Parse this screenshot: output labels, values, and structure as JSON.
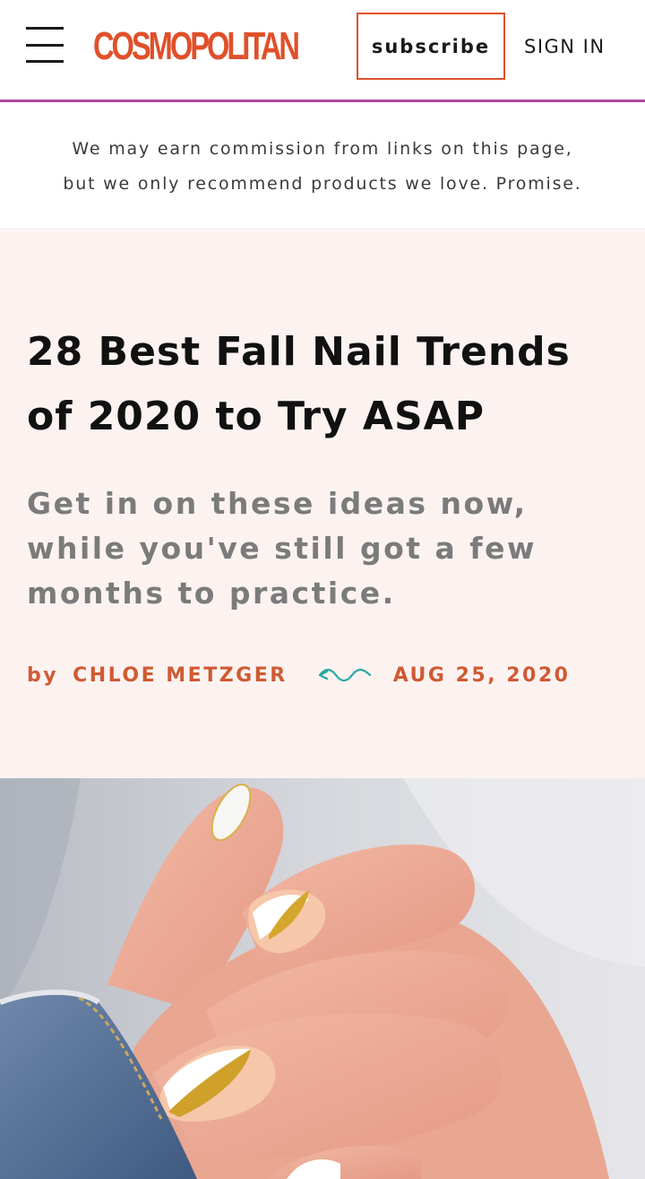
{
  "header": {
    "logo_text": "COSMOPOLITAN",
    "subscribe_label": "subscribe",
    "signin_label": "SIGN IN",
    "brand_color": "#e0502a",
    "divider_color": "#b4469e"
  },
  "disclaimer": {
    "line1": "We may earn commission from links on this page,",
    "line2": "but we only recommend products we love. Promise."
  },
  "article": {
    "headline_line1": "28 Best Fall Nail Trends",
    "headline_line2": "of 2020 to Try ASAP",
    "dek": "Get in on these ideas now, while you've still got a few months to practice.",
    "byline_prefix": "by",
    "author": "CHLOE METZGER",
    "date": "AUG 25, 2020",
    "hero_background": "#fcf3f1",
    "accent_color": "#d05a33"
  },
  "icons": {
    "menu": "hamburger-menu-icon",
    "divider": "squiggle-divider-icon"
  }
}
